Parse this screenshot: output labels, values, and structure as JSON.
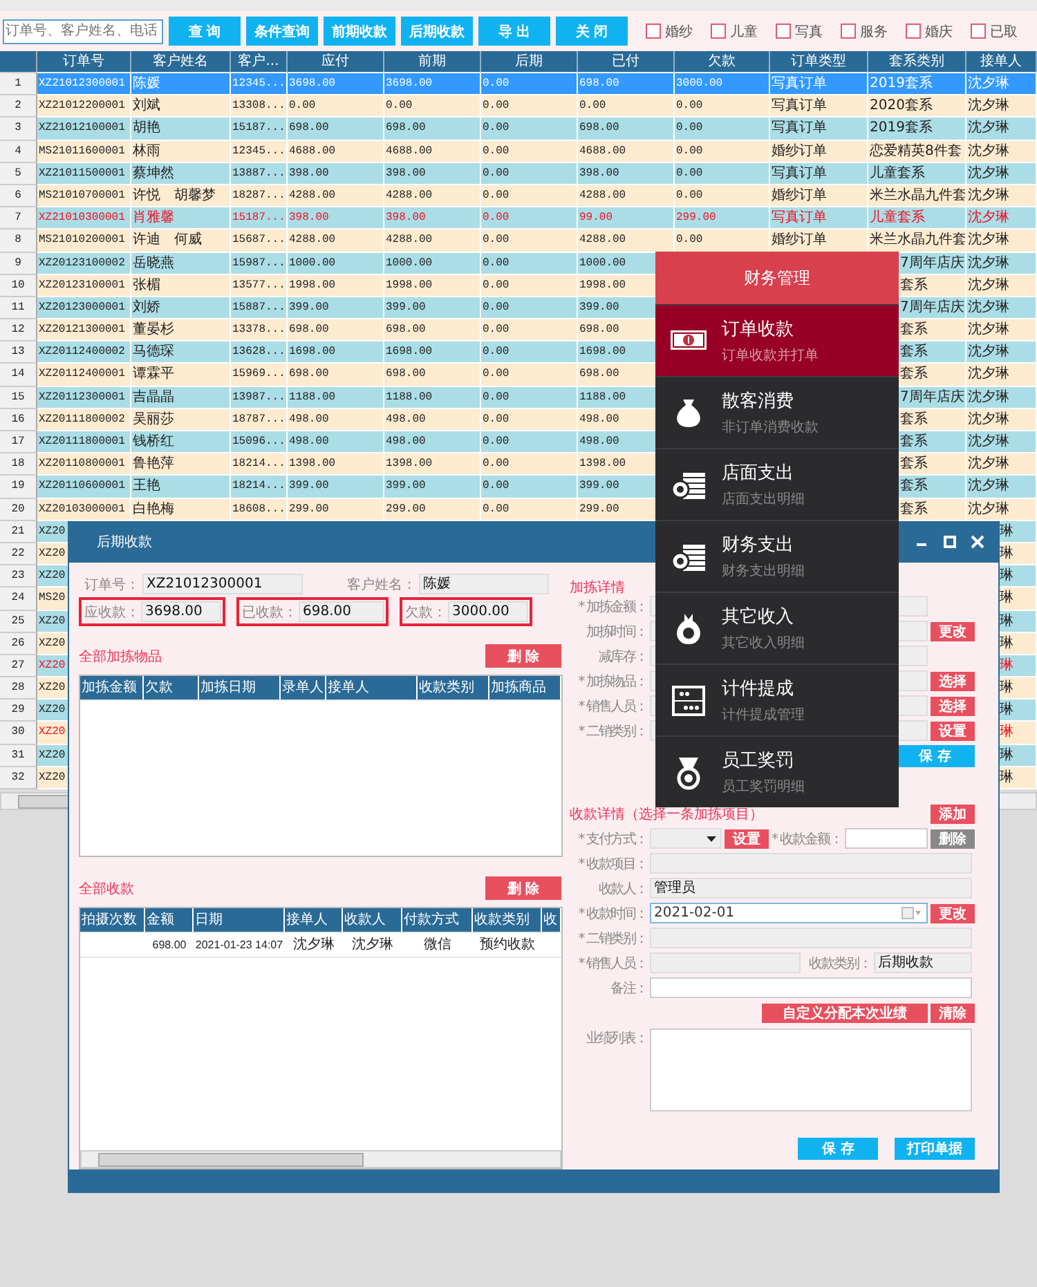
{
  "toolbar": {
    "search": {
      "placeholder": "订单号、客户姓名、电话"
    },
    "buttons": [
      "查 询",
      "条件查询",
      "前期收款",
      "后期收款",
      "导 出",
      "关 闭"
    ],
    "filters": [
      {
        "label": "婚纱",
        "checked": false
      },
      {
        "label": "儿童",
        "checked": false
      },
      {
        "label": "写真",
        "checked": false
      },
      {
        "label": "服务",
        "checked": false
      },
      {
        "label": "婚庆",
        "checked": false
      },
      {
        "label": "已取",
        "checked": false
      }
    ]
  },
  "table": {
    "columns": [
      "订单号",
      "客户姓名",
      "客户...",
      "应付",
      "前期",
      "后期",
      "已付",
      "欠款",
      "订单类型",
      "套系类别",
      "接单人"
    ],
    "rows": [
      {
        "index": "1",
        "order_no": "XZ21012300001",
        "customer": "陈媛",
        "phone": "12345...",
        "due": "3698.00",
        "prior": "3698.00",
        "later": "0.00",
        "paid": "698.00",
        "owed": "3000.00",
        "order_type": "写真订单",
        "package": "2019套系",
        "receiver": "沈夕琳",
        "selected": true,
        "alert": false
      },
      {
        "index": "2",
        "order_no": "XZ21012200001",
        "customer": "刘斌",
        "phone": "13308...",
        "due": "0.00",
        "prior": "0.00",
        "later": "0.00",
        "paid": "0.00",
        "owed": "0.00",
        "order_type": "写真订单",
        "package": "2020套系",
        "receiver": "沈夕琳",
        "selected": false,
        "alert": false
      },
      {
        "index": "3",
        "order_no": "XZ21012100001",
        "customer": "胡艳",
        "phone": "15187...",
        "due": "698.00",
        "prior": "698.00",
        "later": "0.00",
        "paid": "698.00",
        "owed": "0.00",
        "order_type": "写真订单",
        "package": "2019套系",
        "receiver": "沈夕琳",
        "selected": false,
        "alert": false
      },
      {
        "index": "4",
        "order_no": "MS21011600001",
        "customer": "林雨",
        "phone": "12345...",
        "due": "4688.00",
        "prior": "4688.00",
        "later": "0.00",
        "paid": "4688.00",
        "owed": "0.00",
        "order_type": "婚纱订单",
        "package": "恋爱精英8件套",
        "receiver": "沈夕琳",
        "selected": false,
        "alert": false
      },
      {
        "index": "5",
        "order_no": "XZ21011500001",
        "customer": "蔡坤然",
        "phone": "13887...",
        "due": "398.00",
        "prior": "398.00",
        "later": "0.00",
        "paid": "398.00",
        "owed": "0.00",
        "order_type": "写真订单",
        "package": "儿童套系",
        "receiver": "沈夕琳",
        "selected": false,
        "alert": false
      },
      {
        "index": "6",
        "order_no": "MS21010700001",
        "customer": "许悦　胡馨梦",
        "phone": "18287...",
        "due": "4288.00",
        "prior": "4288.00",
        "later": "0.00",
        "paid": "4288.00",
        "owed": "0.00",
        "order_type": "婚纱订单",
        "package": "米兰水晶九件套",
        "receiver": "沈夕琳",
        "selected": false,
        "alert": false
      },
      {
        "index": "7",
        "order_no": "XZ21010300001",
        "customer": "肖雅馨",
        "phone": "15187...",
        "due": "398.00",
        "prior": "398.00",
        "later": "0.00",
        "paid": "99.00",
        "owed": "299.00",
        "order_type": "写真订单",
        "package": "儿童套系",
        "receiver": "沈夕琳",
        "selected": false,
        "alert": true
      },
      {
        "index": "8",
        "order_no": "MS21010200001",
        "customer": "许迪　何威",
        "phone": "15687...",
        "due": "4288.00",
        "prior": "4288.00",
        "later": "0.00",
        "paid": "4288.00",
        "owed": "0.00",
        "order_type": "婚纱订单",
        "package": "米兰水晶九件套",
        "receiver": "沈夕琳",
        "selected": false,
        "alert": false
      },
      {
        "index": "9",
        "order_no": "XZ20123100002",
        "customer": "岳晓燕",
        "phone": "15987...",
        "due": "1000.00",
        "prior": "1000.00",
        "later": "0.00",
        "paid": "1000.00",
        "package": "7周年店庆",
        "receiver": "沈夕琳",
        "selected": false,
        "alert": false
      },
      {
        "index": "10",
        "order_no": "XZ20123100001",
        "customer": "张楣",
        "phone": "13577...",
        "due": "1998.00",
        "prior": "1998.00",
        "later": "0.00",
        "paid": "1998.00",
        "package": "套系",
        "receiver": "沈夕琳",
        "selected": false,
        "alert": false
      },
      {
        "index": "11",
        "order_no": "XZ20123000001",
        "customer": "刘娇",
        "phone": "15887...",
        "due": "399.00",
        "prior": "399.00",
        "later": "0.00",
        "paid": "399.00",
        "package": "7周年店庆",
        "receiver": "沈夕琳",
        "selected": false,
        "alert": false
      },
      {
        "index": "12",
        "order_no": "XZ20121300001",
        "customer": "董晏杉",
        "phone": "13378...",
        "due": "698.00",
        "prior": "698.00",
        "later": "0.00",
        "paid": "698.00",
        "package": "套系",
        "receiver": "沈夕琳",
        "selected": false,
        "alert": false
      },
      {
        "index": "13",
        "order_no": "XZ20112400002",
        "customer": "马德琛",
        "phone": "13628...",
        "due": "1698.00",
        "prior": "1698.00",
        "later": "0.00",
        "paid": "1698.00",
        "package": "套系",
        "receiver": "沈夕琳",
        "selected": false,
        "alert": false
      },
      {
        "index": "14",
        "order_no": "XZ20112400001",
        "customer": "谭霖平",
        "phone": "15969...",
        "due": "698.00",
        "prior": "698.00",
        "later": "0.00",
        "paid": "698.00",
        "package": "套系",
        "receiver": "沈夕琳",
        "selected": false,
        "alert": false
      },
      {
        "index": "15",
        "order_no": "XZ20112300001",
        "customer": "吉晶晶",
        "phone": "13987...",
        "due": "1188.00",
        "prior": "1188.00",
        "later": "0.00",
        "paid": "1188.00",
        "package": "7周年店庆",
        "receiver": "沈夕琳",
        "selected": false,
        "alert": false
      },
      {
        "index": "16",
        "order_no": "XZ20111800002",
        "customer": "吴丽莎",
        "phone": "18787...",
        "due": "498.00",
        "prior": "498.00",
        "later": "0.00",
        "paid": "498.00",
        "package": "套系",
        "receiver": "沈夕琳",
        "selected": false,
        "alert": false
      },
      {
        "index": "17",
        "order_no": "XZ20111800001",
        "customer": "钱桥红",
        "phone": "15096...",
        "due": "498.00",
        "prior": "498.00",
        "later": "0.00",
        "paid": "498.00",
        "package": "套系",
        "receiver": "沈夕琳",
        "selected": false,
        "alert": false
      },
      {
        "index": "18",
        "order_no": "XZ20110800001",
        "customer": "鲁艳萍",
        "phone": "18214...",
        "due": "1398.00",
        "prior": "1398.00",
        "later": "0.00",
        "paid": "1398.00",
        "package": "套系",
        "receiver": "沈夕琳",
        "selected": false,
        "alert": false
      },
      {
        "index": "19",
        "order_no": "XZ20110600001",
        "customer": "王艳",
        "phone": "18214...",
        "due": "399.00",
        "prior": "399.00",
        "later": "0.00",
        "paid": "399.00",
        "package": "套系",
        "receiver": "沈夕琳",
        "selected": false,
        "alert": false
      },
      {
        "index": "20",
        "order_no": "XZ20103000001",
        "customer": "白艳梅",
        "phone": "18608...",
        "due": "299.00",
        "prior": "299.00",
        "later": "0.00",
        "paid": "299.00",
        "package": "套系",
        "receiver": "沈夕琳",
        "selected": false,
        "alert": false
      },
      {
        "index": "21",
        "order_no": "XZ20",
        "receiver": "琳",
        "selected": false,
        "alert": false
      },
      {
        "index": "22",
        "order_no": "XZ20",
        "receiver": "琳",
        "selected": false,
        "alert": false
      },
      {
        "index": "23",
        "order_no": "XZ20",
        "receiver": "琳",
        "selected": false,
        "alert": false
      },
      {
        "index": "24",
        "order_no": "MS20",
        "receiver": "琳",
        "selected": false,
        "alert": false
      },
      {
        "index": "25",
        "order_no": "XZ20",
        "receiver": "琳",
        "selected": false,
        "alert": false
      },
      {
        "index": "26",
        "order_no": "XZ20",
        "receiver": "琳",
        "selected": false,
        "alert": false
      },
      {
        "index": "27",
        "order_no": "XZ20",
        "receiver": "琳",
        "selected": false,
        "alert": true
      },
      {
        "index": "28",
        "order_no": "XZ20",
        "receiver": "琳",
        "selected": false,
        "alert": false
      },
      {
        "index": "29",
        "order_no": "XZ20",
        "receiver": "琳",
        "selected": false,
        "alert": false
      },
      {
        "index": "30",
        "order_no": "XZ20",
        "receiver": "琳",
        "selected": false,
        "alert": true
      },
      {
        "index": "31",
        "order_no": "XZ20",
        "receiver": "琳",
        "selected": false,
        "alert": false
      },
      {
        "index": "32",
        "order_no": "XZ20",
        "receiver": "琳",
        "selected": false,
        "alert": false
      }
    ]
  },
  "dialog": {
    "title": "后期收款",
    "order_no": {
      "label": "订单号：",
      "value": "XZ21012300001"
    },
    "customer": {
      "label": "客户姓名：",
      "value": "陈媛"
    },
    "amounts": [
      {
        "label": "应收款：",
        "value": "3698.00"
      },
      {
        "label": "已收款：",
        "value": "698.00"
      },
      {
        "label": "欠款：",
        "value": "3000.00"
      }
    ],
    "items_section": {
      "title": "全部加拣物品",
      "button": "删 除",
      "columns": [
        "加拣金额",
        "欠款",
        "加拣日期",
        "录单人",
        "接单人",
        "收款类别",
        "加拣商品"
      ]
    },
    "payments_section": {
      "title": "全部收款",
      "button": "删 除",
      "columns": [
        "拍摄次数",
        "金额",
        "日期",
        "接单人",
        "收款人",
        "付款方式",
        "收款类别",
        "收"
      ],
      "rows": [
        {
          "amount": "698.00",
          "date": "2021-01-23 14:07",
          "taker": "沈夕琳",
          "collector": "沈夕琳",
          "method": "微信",
          "category": "预约收款"
        }
      ]
    },
    "addon_details": {
      "title": "加拣详情",
      "fields": [
        {
          "label": "* 加拣金额："
        },
        {
          "label": "加拣时间：",
          "button": "更改"
        },
        {
          "label": "减库存："
        },
        {
          "label": "* 加拣物品：",
          "button": "选择"
        },
        {
          "label": "* 销售人员：",
          "button": "选择"
        },
        {
          "label": "* 二销类别：",
          "button": "设置"
        }
      ],
      "save_button": "保 存"
    },
    "payment_details": {
      "title": "收款详情（选择一条加拣项目）",
      "add_button": "添加",
      "method": {
        "label": "* 支付方式：",
        "button": "设置"
      },
      "amount": {
        "label": "* 收款金额：",
        "button": "删除",
        "disabled": true
      },
      "fields": [
        {
          "kind": "text",
          "label": "* 收款项目："
        },
        {
          "kind": "text",
          "label": "收款人：",
          "value": "管理员"
        },
        {
          "kind": "date",
          "label": "* 收款时间：",
          "value": "2021-02-01",
          "button": "更改"
        },
        {
          "kind": "text",
          "label": "* 二销类别："
        },
        {
          "kind": "split",
          "label": "* 销售人员：",
          "second_label": "收款类别：",
          "second_value": "后期收款"
        },
        {
          "kind": "input",
          "label": "备注："
        }
      ],
      "allocate_button": "自定义分配本次业绩",
      "clear_button": "清除",
      "performance_label": "业绩列表：",
      "save_button": "保 存",
      "print_button": "打印单据"
    }
  },
  "menu": {
    "title": "财务管理",
    "items": [
      {
        "title": "订单收款",
        "subtitle": "订单收款并打单",
        "selected": true
      },
      {
        "title": "散客消费",
        "subtitle": "非订单消费收款",
        "selected": false
      },
      {
        "title": "店面支出",
        "subtitle": "店面支出明细",
        "selected": false
      },
      {
        "title": "财务支出",
        "subtitle": "财务支出明细",
        "selected": false
      },
      {
        "title": "其它收入",
        "subtitle": "其它收入明细",
        "selected": false
      },
      {
        "title": "计件提成",
        "subtitle": "计件提成管理",
        "selected": false
      },
      {
        "title": "员工奖罚",
        "subtitle": "员工奖罚明细",
        "selected": false
      }
    ]
  }
}
